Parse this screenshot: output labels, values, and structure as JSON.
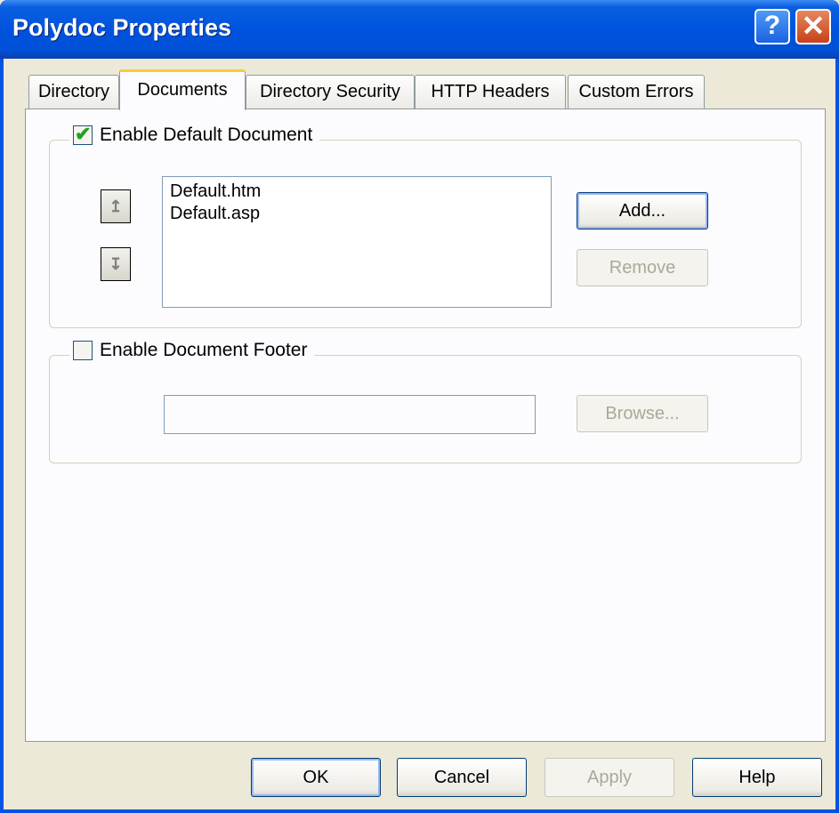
{
  "window": {
    "title": "Polydoc Properties"
  },
  "titlebar_buttons": {
    "help": "?",
    "close": "✕"
  },
  "tabs": [
    {
      "label": "Directory"
    },
    {
      "label": "Documents"
    },
    {
      "label": "Directory Security"
    },
    {
      "label": "HTTP Headers"
    },
    {
      "label": "Custom Errors"
    }
  ],
  "default_document": {
    "label": "Enable Default Document",
    "checked": true,
    "items": [
      "Default.htm",
      "Default.asp"
    ],
    "move_up_glyph": "↥",
    "move_down_glyph": "↧",
    "add_label": "Add...",
    "remove_label": "Remove"
  },
  "document_footer": {
    "label": "Enable Document Footer",
    "checked": false,
    "path_value": "",
    "browse_label": "Browse..."
  },
  "footer_buttons": {
    "ok": "OK",
    "cancel": "Cancel",
    "apply": "Apply",
    "help": "Help"
  },
  "colors": {
    "title_bar": "#0053df",
    "check": "#21a121",
    "tab_highlight": "#ffc83c"
  }
}
